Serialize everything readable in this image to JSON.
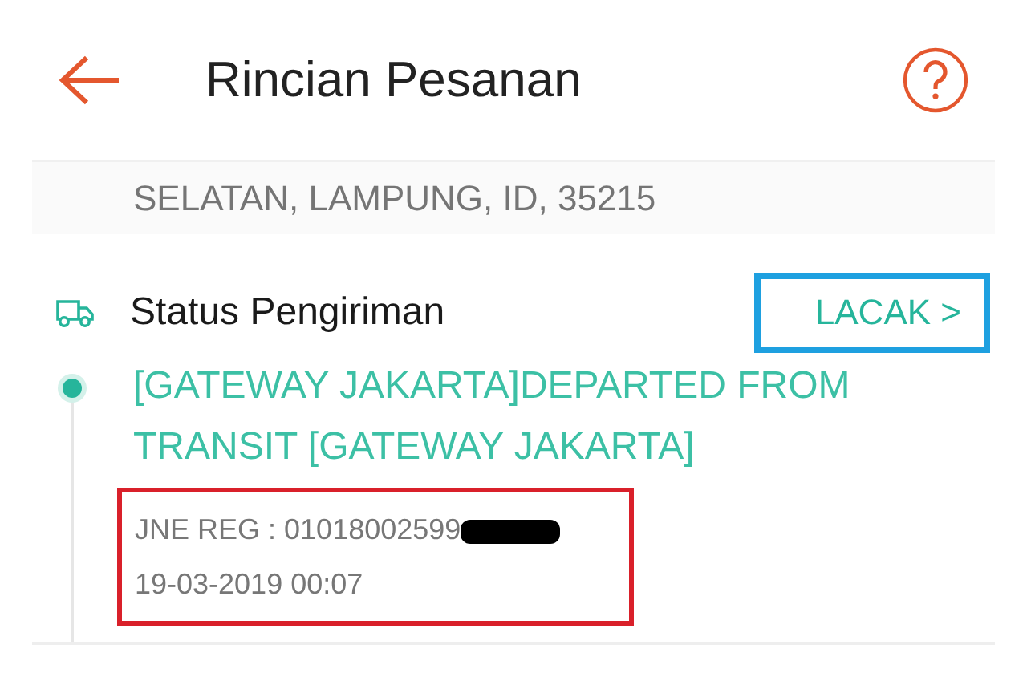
{
  "header": {
    "title": "Rincian Pesanan"
  },
  "address": {
    "text": "SELATAN, LAMPUNG, ID, 35215"
  },
  "shipping": {
    "title": "Status Pengiriman",
    "track_button": "LACAK >",
    "latest_event": "[GATEWAY JAKARTA]DEPARTED FROM TRANSIT [GATEWAY JAKARTA]",
    "courier": "JNE REG :",
    "tracking_number": "01018002599",
    "timestamp": "19-03-2019 00:07"
  }
}
